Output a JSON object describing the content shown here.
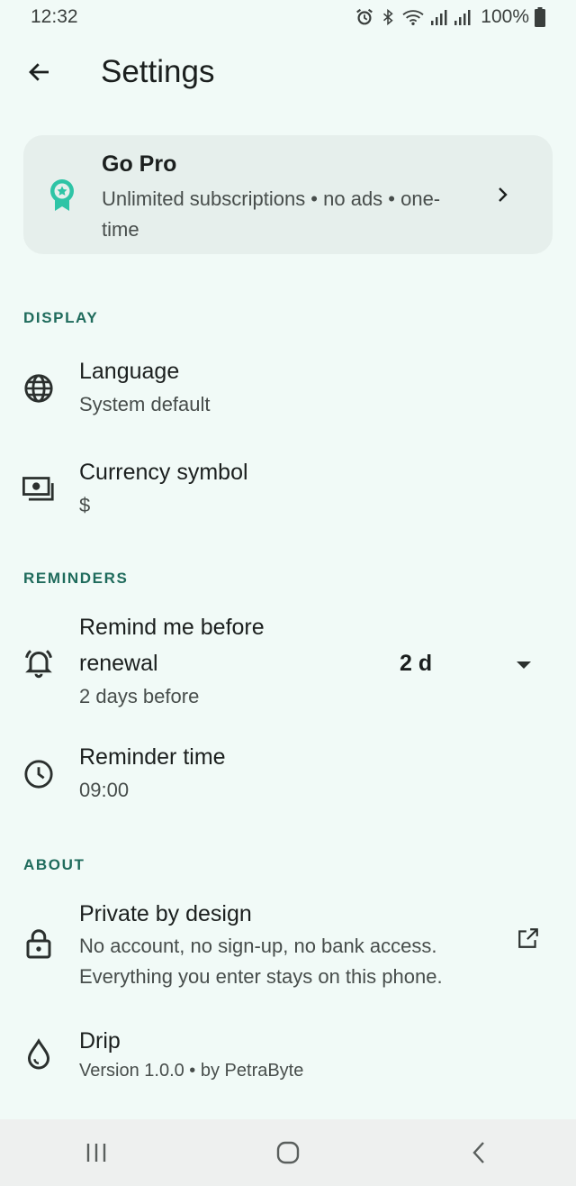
{
  "status_bar": {
    "time": "12:32",
    "battery": "100%",
    "icons": [
      "alarm-icon",
      "bluetooth-icon",
      "wifi-icon",
      "signal-icon",
      "signal-icon",
      "battery-icon"
    ]
  },
  "app_bar": {
    "title": "Settings",
    "back_icon": "arrow-back-icon"
  },
  "pro_card": {
    "title": "Go Pro",
    "subtitle": "Unlimited subscriptions • no ads • one-time",
    "icon": "award-icon",
    "accent_color": "#2ec4a6"
  },
  "sections": {
    "display": "DISPLAY",
    "reminders": "REMINDERS",
    "about": "ABOUT"
  },
  "display": {
    "language": {
      "title": "Language",
      "value": "System default",
      "icon": "globe-icon"
    },
    "currency": {
      "title": "Currency symbol",
      "value": "$",
      "icon": "payments-icon"
    }
  },
  "reminders": {
    "remind_before": {
      "title_line1": "Remind me before",
      "title_line2": "renewal",
      "value": "2 days before",
      "selected": "2 d",
      "icon": "bell-icon"
    },
    "reminder_time": {
      "title": "Reminder time",
      "value": "09:00",
      "icon": "clock-icon"
    }
  },
  "about": {
    "privacy": {
      "title": "Private by design",
      "line1": "No account, no sign-up, no bank access.",
      "line2": "Everything you enter stays on this phone.",
      "icon": "lock-icon"
    },
    "app": {
      "title": "Drip",
      "version": "Version 1.0.0 • by PetraByte",
      "icon": "drop-icon"
    }
  },
  "colors": {
    "background": "#f1faf7",
    "section_header": "#1f6b5c",
    "card": "#e6efec"
  }
}
